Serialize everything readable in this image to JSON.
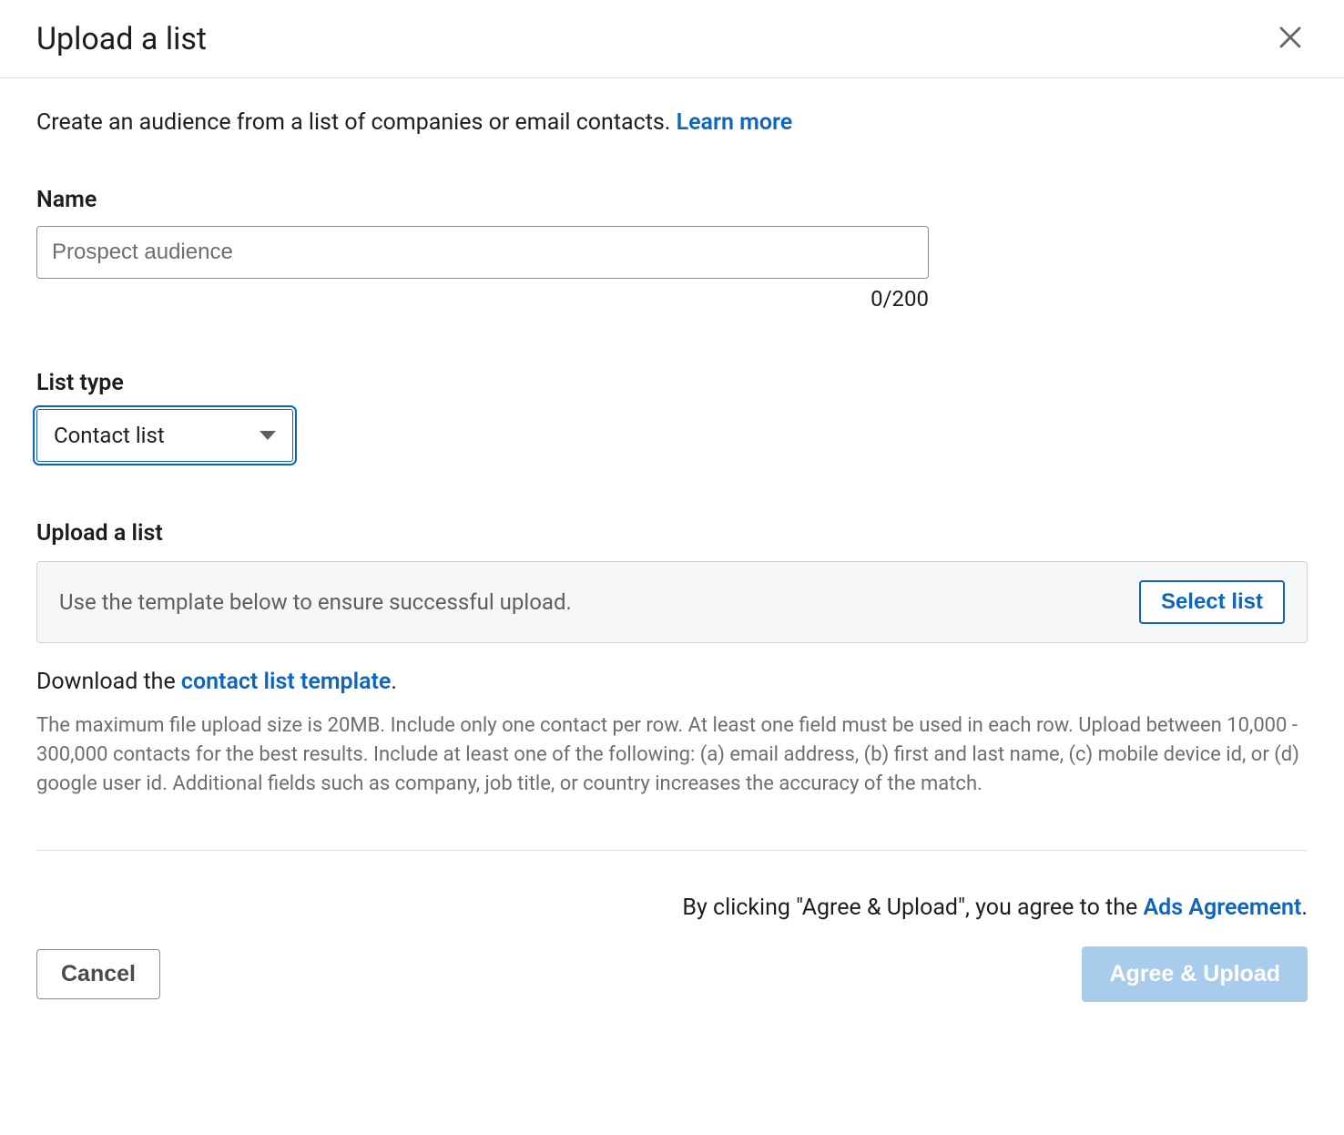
{
  "header": {
    "title": "Upload a list"
  },
  "intro": {
    "text": "Create an audience from a list of companies or email contacts. ",
    "learn_more": "Learn more"
  },
  "name": {
    "label": "Name",
    "placeholder": "Prospect audience",
    "value": "",
    "char_count": "0/200"
  },
  "list_type": {
    "label": "List type",
    "selected": "Contact list"
  },
  "upload": {
    "label": "Upload a list",
    "box_text": "Use the template below to ensure successful upload.",
    "select_list": "Select list"
  },
  "download": {
    "prefix": "Download the ",
    "link": "contact list template",
    "suffix": "."
  },
  "help_text": "The maximum file upload size is 20MB. Include only one contact per row. At least one field must be used in each row. Upload between 10,000 - 300,000 contacts for the best results. Include at least one of the following: (a) email address, (b) first and last name, (c) mobile device id, or (d) google user id. Additional fields such as company, job title, or country increases the accuracy of the match.",
  "agreement": {
    "prefix": "By clicking \"Agree & Upload\", you agree to the ",
    "link": "Ads Agreement",
    "suffix": "."
  },
  "footer": {
    "cancel": "Cancel",
    "agree_upload": "Agree & Upload"
  }
}
